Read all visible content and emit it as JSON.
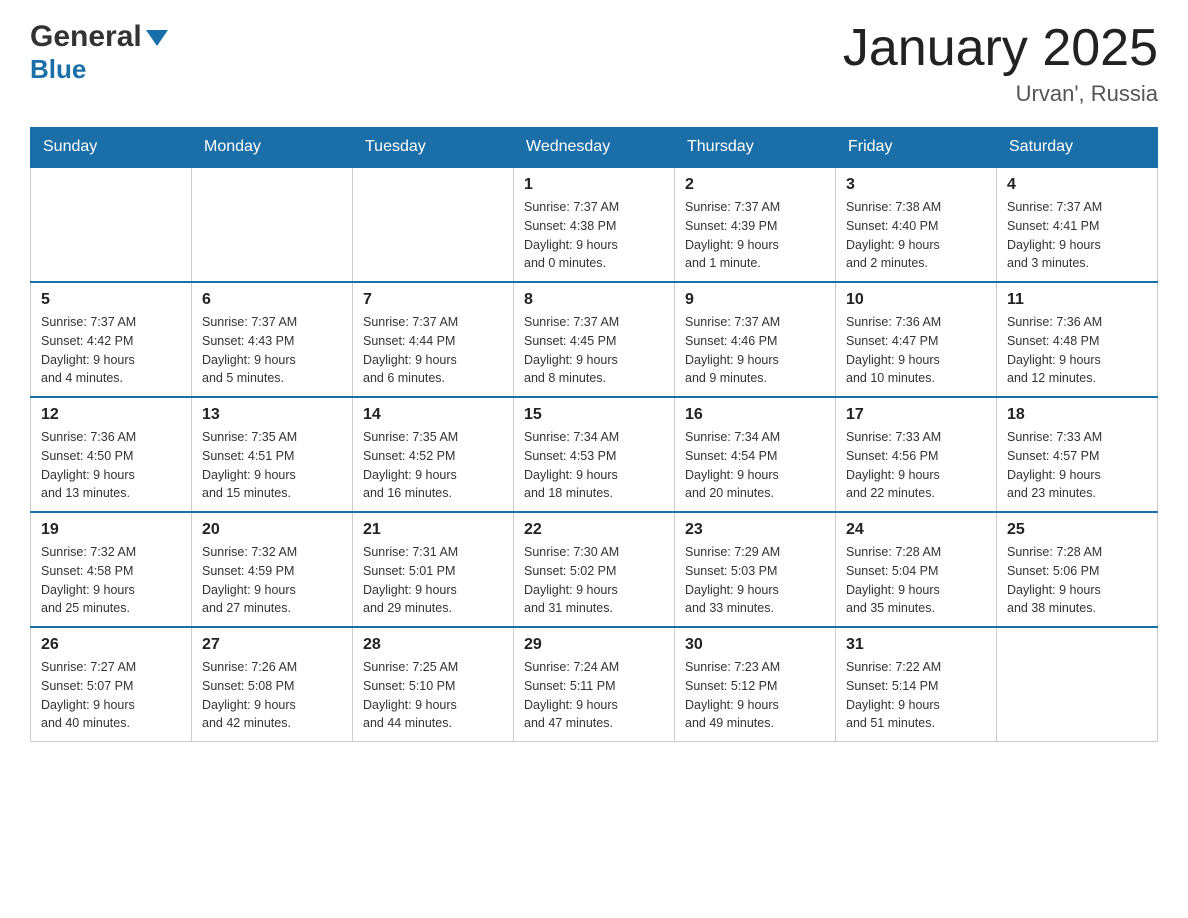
{
  "header": {
    "logo_general": "General",
    "logo_blue": "Blue",
    "main_title": "January 2025",
    "subtitle": "Urvan', Russia"
  },
  "calendar": {
    "days_of_week": [
      "Sunday",
      "Monday",
      "Tuesday",
      "Wednesday",
      "Thursday",
      "Friday",
      "Saturday"
    ],
    "weeks": [
      {
        "days": [
          {
            "number": "",
            "info": ""
          },
          {
            "number": "",
            "info": ""
          },
          {
            "number": "",
            "info": ""
          },
          {
            "number": "1",
            "info": "Sunrise: 7:37 AM\nSunset: 4:38 PM\nDaylight: 9 hours\nand 0 minutes."
          },
          {
            "number": "2",
            "info": "Sunrise: 7:37 AM\nSunset: 4:39 PM\nDaylight: 9 hours\nand 1 minute."
          },
          {
            "number": "3",
            "info": "Sunrise: 7:38 AM\nSunset: 4:40 PM\nDaylight: 9 hours\nand 2 minutes."
          },
          {
            "number": "4",
            "info": "Sunrise: 7:37 AM\nSunset: 4:41 PM\nDaylight: 9 hours\nand 3 minutes."
          }
        ]
      },
      {
        "days": [
          {
            "number": "5",
            "info": "Sunrise: 7:37 AM\nSunset: 4:42 PM\nDaylight: 9 hours\nand 4 minutes."
          },
          {
            "number": "6",
            "info": "Sunrise: 7:37 AM\nSunset: 4:43 PM\nDaylight: 9 hours\nand 5 minutes."
          },
          {
            "number": "7",
            "info": "Sunrise: 7:37 AM\nSunset: 4:44 PM\nDaylight: 9 hours\nand 6 minutes."
          },
          {
            "number": "8",
            "info": "Sunrise: 7:37 AM\nSunset: 4:45 PM\nDaylight: 9 hours\nand 8 minutes."
          },
          {
            "number": "9",
            "info": "Sunrise: 7:37 AM\nSunset: 4:46 PM\nDaylight: 9 hours\nand 9 minutes."
          },
          {
            "number": "10",
            "info": "Sunrise: 7:36 AM\nSunset: 4:47 PM\nDaylight: 9 hours\nand 10 minutes."
          },
          {
            "number": "11",
            "info": "Sunrise: 7:36 AM\nSunset: 4:48 PM\nDaylight: 9 hours\nand 12 minutes."
          }
        ]
      },
      {
        "days": [
          {
            "number": "12",
            "info": "Sunrise: 7:36 AM\nSunset: 4:50 PM\nDaylight: 9 hours\nand 13 minutes."
          },
          {
            "number": "13",
            "info": "Sunrise: 7:35 AM\nSunset: 4:51 PM\nDaylight: 9 hours\nand 15 minutes."
          },
          {
            "number": "14",
            "info": "Sunrise: 7:35 AM\nSunset: 4:52 PM\nDaylight: 9 hours\nand 16 minutes."
          },
          {
            "number": "15",
            "info": "Sunrise: 7:34 AM\nSunset: 4:53 PM\nDaylight: 9 hours\nand 18 minutes."
          },
          {
            "number": "16",
            "info": "Sunrise: 7:34 AM\nSunset: 4:54 PM\nDaylight: 9 hours\nand 20 minutes."
          },
          {
            "number": "17",
            "info": "Sunrise: 7:33 AM\nSunset: 4:56 PM\nDaylight: 9 hours\nand 22 minutes."
          },
          {
            "number": "18",
            "info": "Sunrise: 7:33 AM\nSunset: 4:57 PM\nDaylight: 9 hours\nand 23 minutes."
          }
        ]
      },
      {
        "days": [
          {
            "number": "19",
            "info": "Sunrise: 7:32 AM\nSunset: 4:58 PM\nDaylight: 9 hours\nand 25 minutes."
          },
          {
            "number": "20",
            "info": "Sunrise: 7:32 AM\nSunset: 4:59 PM\nDaylight: 9 hours\nand 27 minutes."
          },
          {
            "number": "21",
            "info": "Sunrise: 7:31 AM\nSunset: 5:01 PM\nDaylight: 9 hours\nand 29 minutes."
          },
          {
            "number": "22",
            "info": "Sunrise: 7:30 AM\nSunset: 5:02 PM\nDaylight: 9 hours\nand 31 minutes."
          },
          {
            "number": "23",
            "info": "Sunrise: 7:29 AM\nSunset: 5:03 PM\nDaylight: 9 hours\nand 33 minutes."
          },
          {
            "number": "24",
            "info": "Sunrise: 7:28 AM\nSunset: 5:04 PM\nDaylight: 9 hours\nand 35 minutes."
          },
          {
            "number": "25",
            "info": "Sunrise: 7:28 AM\nSunset: 5:06 PM\nDaylight: 9 hours\nand 38 minutes."
          }
        ]
      },
      {
        "days": [
          {
            "number": "26",
            "info": "Sunrise: 7:27 AM\nSunset: 5:07 PM\nDaylight: 9 hours\nand 40 minutes."
          },
          {
            "number": "27",
            "info": "Sunrise: 7:26 AM\nSunset: 5:08 PM\nDaylight: 9 hours\nand 42 minutes."
          },
          {
            "number": "28",
            "info": "Sunrise: 7:25 AM\nSunset: 5:10 PM\nDaylight: 9 hours\nand 44 minutes."
          },
          {
            "number": "29",
            "info": "Sunrise: 7:24 AM\nSunset: 5:11 PM\nDaylight: 9 hours\nand 47 minutes."
          },
          {
            "number": "30",
            "info": "Sunrise: 7:23 AM\nSunset: 5:12 PM\nDaylight: 9 hours\nand 49 minutes."
          },
          {
            "number": "31",
            "info": "Sunrise: 7:22 AM\nSunset: 5:14 PM\nDaylight: 9 hours\nand 51 minutes."
          },
          {
            "number": "",
            "info": ""
          }
        ]
      }
    ]
  }
}
